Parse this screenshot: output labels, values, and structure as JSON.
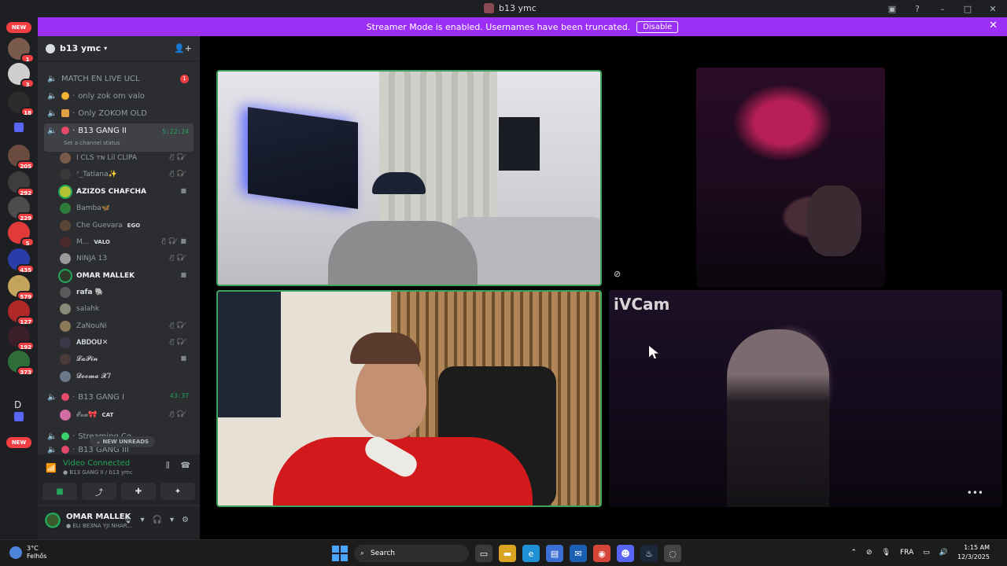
{
  "window": {
    "title": "b13 ymc",
    "tb_icons": [
      "inbox-icon",
      "help-icon",
      "minimize-icon",
      "maximize-icon",
      "close-icon"
    ]
  },
  "banner": {
    "text": "Streamer Mode is enabled. Usernames have been truncated.",
    "button": "Disable"
  },
  "rail": {
    "new_top": "NEW",
    "new_bottom": "NEW",
    "letter": "D",
    "badges": [
      "1",
      "3",
      "18",
      "205",
      "292",
      "229",
      "5",
      "435",
      "579",
      "127",
      "192",
      "373"
    ]
  },
  "guild": {
    "name": "b13 ymc"
  },
  "channels": [
    {
      "name": "MATCH EN LIVE UCL",
      "badge": "1"
    },
    {
      "name": "only zok om valo"
    },
    {
      "name": "Only ZOKOM OLD"
    },
    {
      "name": "B13 GANG II",
      "timer": "5:22:24",
      "status": "Set a channel status"
    },
    {
      "name": "B13 GANG I",
      "timer": "43:37"
    },
    {
      "name": "Streaming Co..."
    },
    {
      "name": "B13 GANG III"
    }
  ],
  "members_ii": [
    {
      "name": "I CLS ᴛɴ Lil CLIPA"
    },
    {
      "name": "ᐟ_Tatiana✨"
    },
    {
      "name": "AZIZOS CHAFCHA"
    },
    {
      "name": "Bamba🦋"
    },
    {
      "name": "Che Guevara",
      "tag": "EGO"
    },
    {
      "name": "M...",
      "tag": "VALO"
    },
    {
      "name": "NINJA 13"
    },
    {
      "name": "OMAR MALLEK"
    },
    {
      "name": "rafa 🐘"
    },
    {
      "name": "salahk"
    },
    {
      "name": "ZaNouNi"
    },
    {
      "name": "𝐀𝐁𝐃𝐎𝐔✕"
    },
    {
      "name": "𝓛𝓪𝓟𝓲𝓷"
    },
    {
      "name": "𝓓𝓸𝓸𝓶𝓪 𝓧7"
    }
  ],
  "members_i": [
    {
      "name": "𝓔𝓿𝓪🎀",
      "tag": "CAT"
    }
  ],
  "new_unreads": "NEW UNREADS",
  "voice": {
    "title": "Video Connected",
    "subtitle": "B13 GANG II / b13 ymc"
  },
  "user": {
    "name": "OMAR MALLEK",
    "status": "ELI BE3NA YJI NHAR..."
  },
  "stage": {
    "watermark": "iVCam"
  },
  "taskbar": {
    "temp": "3°C",
    "weather": "Felhős",
    "search": "Search",
    "lang": "FRA",
    "time": "1:15 AM",
    "date": "12/3/2025"
  },
  "colors": {
    "accent": "#9b2ff6",
    "speaking": "#3ba55d",
    "badge": "#f23f43"
  }
}
